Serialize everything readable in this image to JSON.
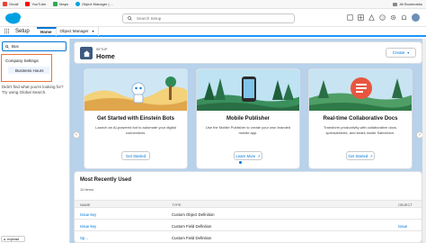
{
  "bookmarks": {
    "items": [
      {
        "label": "Gmail",
        "color": "#ea4335"
      },
      {
        "label": "YouTube",
        "color": "#ff0000"
      },
      {
        "label": "Maps",
        "color": "#34a853"
      },
      {
        "label": "Object Manager | ...",
        "color": "#00a1e0"
      }
    ],
    "all_bookmarks": "All Bookmarks"
  },
  "header": {
    "search_placeholder": "Search Setup"
  },
  "nav": {
    "app_name": "Setup",
    "tabs": [
      {
        "label": "Home"
      },
      {
        "label": "Object Manager"
      }
    ]
  },
  "quickfind": {
    "value": "Bus",
    "parent_item": "Company Settings",
    "child_item": "Business Hours",
    "not_found": "Didn't find what you're looking for? Try using Global Search."
  },
  "setup_header": {
    "eyebrow": "SETUP",
    "title": "Home",
    "create_label": "Create"
  },
  "tiles": [
    {
      "title": "Get Started with Einstein Bots",
      "desc": "Launch an AI-powered bot to automate your digital connections.",
      "button": "Get Started"
    },
    {
      "title": "Mobile Publisher",
      "desc": "Use the Mobile Publisher to create your own branded mobile app.",
      "button": "Learn More"
    },
    {
      "title": "Real-time Collaborative Docs",
      "desc": "Transform productivity with collaborative docs, spreadsheets, and slides inside Salesforce.",
      "button": "Get Started"
    }
  ],
  "mru": {
    "title": "Most Recently Used",
    "count": "10 items",
    "columns": {
      "name": "NAME",
      "type": "TYPE",
      "object": "OBJECT"
    },
    "rows": [
      {
        "name": "Issue key",
        "type": "Custom Object Definition",
        "object": ""
      },
      {
        "name": "Issue key",
        "type": "Custom Field Definition",
        "object": "Issue"
      },
      {
        "name": "Sp...",
        "type": "Custom Field Definition",
        "object": ""
      }
    ]
  },
  "lock_pill": "expense",
  "colors": {
    "brand": "#0176d3",
    "page_bg": "#b7d2ea",
    "highlight": "#e8743b"
  }
}
